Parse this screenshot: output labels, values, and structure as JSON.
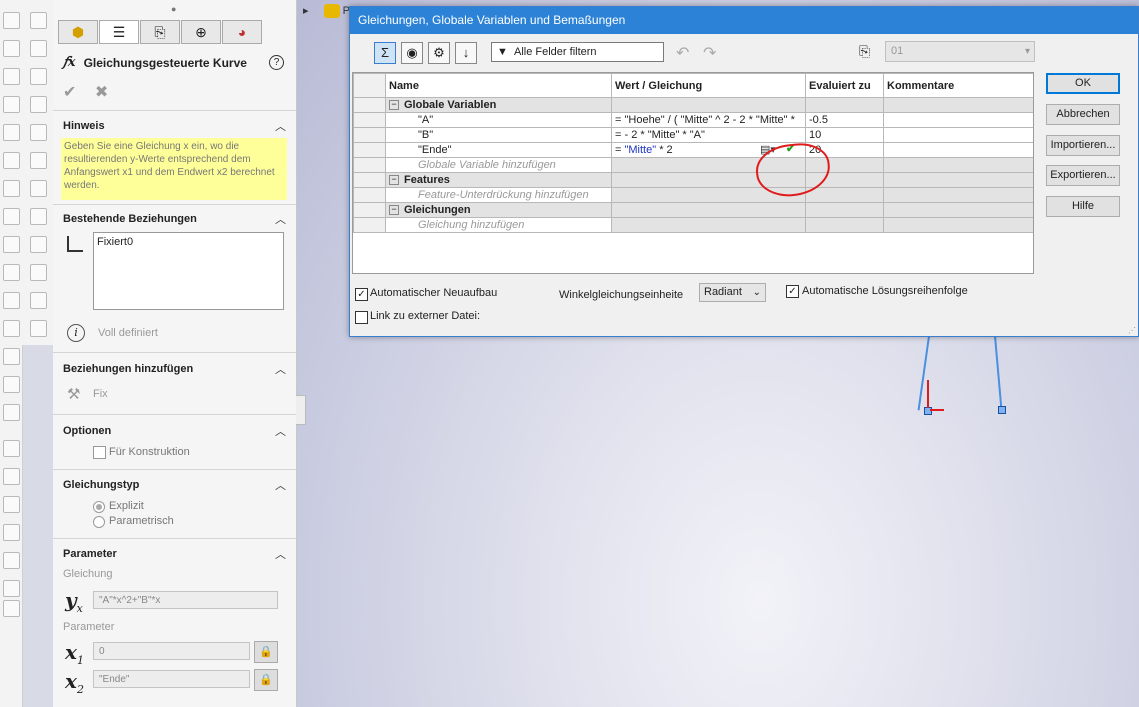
{
  "viewport": {
    "title_fragment": "P"
  },
  "pm": {
    "tabs": [
      "feature-manager",
      "property-manager",
      "configuration-manager",
      "dimxpert-manager",
      "display-manager"
    ],
    "title": "Gleichungsgesteuerte Kurve",
    "help_label": "?",
    "hint": {
      "header": "Hinweis",
      "text": "Geben Sie eine Gleichung x ein, wo die resultierenden y-Werte entsprechend dem Anfangswert x1 und dem Endwert x2 berechnet werden."
    },
    "existing_relations": {
      "header": "Bestehende Beziehungen",
      "items": [
        "Fixiert0"
      ],
      "status": "Voll definiert"
    },
    "add_relations": {
      "header": "Beziehungen hinzufügen",
      "fix_label": "Fix"
    },
    "options": {
      "header": "Optionen",
      "construction_label": "Für Konstruktion"
    },
    "equation_type": {
      "header": "Gleichungstyp",
      "explicit": "Explizit",
      "parametric": "Parametrisch",
      "selected": "Explizit"
    },
    "parameters": {
      "header": "Parameter",
      "equation_label": "Gleichung",
      "equation_value": "\"A\"*x^2+\"B\"*x",
      "param_label": "Parameter",
      "x1_value": "0",
      "x2_value": "\"Ende\""
    }
  },
  "dialog": {
    "title": "Gleichungen, Globale Variablen und Bemaßungen",
    "filter_text": "Alle Felder filtern",
    "configuration": "01",
    "columns": [
      "Name",
      "Wert / Gleichung",
      "Evaluiert zu",
      "Kommentare"
    ],
    "groups": {
      "globals": "Globale Variablen",
      "features": "Features",
      "equations": "Gleichungen"
    },
    "rows": [
      {
        "name": "\"A\"",
        "value": "= \"Hoehe\" / ( \"Mitte\" ^ 2 - 2 * \"Mitte\" * ",
        "eval": "-0.5",
        "comment": ""
      },
      {
        "name": "\"B\"",
        "value": "= - 2 * \"Mitte\" * \"A\"",
        "eval": "10",
        "comment": ""
      },
      {
        "name": "\"Ende\"",
        "value_prefix": "= ",
        "value_var": "\"Mitte\"",
        "value_suffix": " * 2",
        "eval": "20",
        "comment": ""
      }
    ],
    "add_global_hint": "Globale Variable hinzufügen",
    "add_feature_hint": "Feature-Unterdrückung hinzufügen",
    "add_equation_hint": "Gleichung hinzufügen",
    "buttons": {
      "ok": "OK",
      "cancel": "Abbrechen",
      "import": "Importieren...",
      "export": "Exportieren...",
      "help": "Hilfe"
    },
    "auto_rebuild": {
      "label": "Automatischer Neuaufbau",
      "checked": true
    },
    "link_external": {
      "label": "Link zu externer Datei:",
      "checked": false
    },
    "angle_unit_label": "Winkelgleichungseinheite",
    "angle_unit_value": "Radiant",
    "auto_order": {
      "label": "Automatische Lösungsreihenfolge",
      "checked": true
    }
  }
}
